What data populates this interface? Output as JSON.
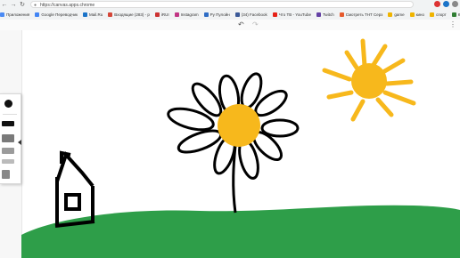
{
  "browser": {
    "url": "https://canvas.apps.chrome",
    "bookmarks": [
      {
        "label": "Приложения",
        "color": "#4a8af4"
      },
      {
        "label": "Google Переводчик",
        "color": "#4285f4"
      },
      {
        "label": "Mail.Ru",
        "color": "#1a73c8"
      },
      {
        "label": "Входящие (283) - р",
        "color": "#d44638"
      },
      {
        "label": "iRUI",
        "color": "#cc3333"
      },
      {
        "label": "Instagram",
        "color": "#c13584"
      },
      {
        "label": "Ру Пулойн",
        "color": "#2d6cc4"
      },
      {
        "label": "(34) Facebook",
        "color": "#3b5998"
      },
      {
        "label": "Что ТВ - YouTube",
        "color": "#e62117"
      },
      {
        "label": "Twitch",
        "color": "#6441a5"
      },
      {
        "label": "Смотреть ТНТ Серз",
        "color": "#e65a2d"
      },
      {
        "label": "game",
        "color": "#f0b400"
      },
      {
        "label": "кино",
        "color": "#f0b400"
      },
      {
        "label": "спорт",
        "color": "#f0b400"
      },
      {
        "label": "Календарь8Я бесп",
        "color": "#2e7d32"
      },
      {
        "label": "Загрузки",
        "color": "#4a8af4"
      }
    ]
  },
  "app": {
    "undo_icon": "undo-icon",
    "redo_icon": "redo-icon",
    "menu_icon": "more-vert-icon"
  },
  "tools": {
    "brush_color": "#111111",
    "palette_colors": [
      "#111111",
      "#7a7a7a",
      "#9b9b9b",
      "#bbbbbb",
      "#888888"
    ]
  },
  "drawing_colors": {
    "sun": "#f7b81c",
    "flower_center": "#f7b81c",
    "grass": "#2e9e49",
    "outline": "#000000"
  }
}
